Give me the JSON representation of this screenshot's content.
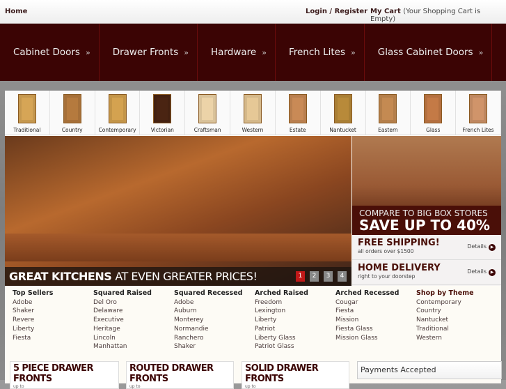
{
  "topbar": {
    "home": "Home",
    "login": "Login / Register",
    "cart": "My Cart",
    "cart_note": "(Your Shopping Cart is Empty)"
  },
  "nav": [
    {
      "label": "Cabinet Doors"
    },
    {
      "label": "Drawer Fronts"
    },
    {
      "label": "Hardware"
    },
    {
      "label": "French Lites"
    },
    {
      "label": "Glass Cabinet Doors"
    }
  ],
  "nav_chevron": "»",
  "door_styles": [
    {
      "label": "Traditional",
      "color": "#d6a556"
    },
    {
      "label": "Country",
      "color": "#b57a3e"
    },
    {
      "label": "Contemporary",
      "color": "#d4a250"
    },
    {
      "label": "Victorian",
      "color": "#4a2412"
    },
    {
      "label": "Craftsman",
      "color": "#ecd3a8"
    },
    {
      "label": "Western",
      "color": "#e6c896"
    },
    {
      "label": "Estate",
      "color": "#c98a56"
    },
    {
      "label": "Nantucket",
      "color": "#b88a3a"
    },
    {
      "label": "Eastern",
      "color": "#c48a52"
    },
    {
      "label": "Glass",
      "color": "#c47a46"
    },
    {
      "label": "French Lites",
      "color": "#d0946a"
    }
  ],
  "hero": {
    "caption_bold": "GREAT KITCHENS",
    "caption_rest": "AT EVEN GREATER PRICES!",
    "pages": [
      "1",
      "2",
      "3",
      "4"
    ],
    "active_page": "1"
  },
  "promo": {
    "line1": "COMPARE TO BIG BOX STORES",
    "line2": "SAVE UP TO 40%"
  },
  "perks": [
    {
      "title": "FREE SHIPPING!",
      "sub": "all orders over $1500",
      "details": "Details"
    },
    {
      "title": "HOME DELIVERY",
      "sub": "right to your doorstep",
      "details": "Details"
    }
  ],
  "link_columns": [
    {
      "title": "Top Sellers",
      "items": [
        "Adobe",
        "Shaker",
        "Revere",
        "Liberty",
        "Fiesta"
      ]
    },
    {
      "title": "Squared Raised",
      "items": [
        "Del Oro",
        "Delaware",
        "Executive",
        "Heritage",
        "Lincoln",
        "Manhattan"
      ]
    },
    {
      "title": "Squared Recessed",
      "items": [
        "Adobe",
        "Auburn",
        "Monterey",
        "Normandie",
        "Ranchero",
        "Shaker"
      ]
    },
    {
      "title": "Arched Raised",
      "items": [
        "Freedom",
        "Lexington",
        "Liberty",
        "Patriot",
        "Liberty Glass",
        "Patriot Glass"
      ]
    },
    {
      "title": "Arched Recessed",
      "items": [
        "Cougar",
        "Fiesta",
        "Mission",
        "Fiesta Glass",
        "Mission Glass"
      ]
    },
    {
      "title": "Shop by Theme",
      "items": [
        "Contemporary",
        "Country",
        "Nantucket",
        "Traditional",
        "Western"
      ]
    }
  ],
  "product_boxes": [
    {
      "title": "5 PIECE DRAWER FRONTS",
      "sub": "up to"
    },
    {
      "title": "ROUTED DRAWER FRONTS",
      "sub": "up to"
    },
    {
      "title": "SOLID DRAWER FRONTS",
      "sub": "up to"
    }
  ],
  "payments": {
    "title": "Payments Accepted"
  }
}
